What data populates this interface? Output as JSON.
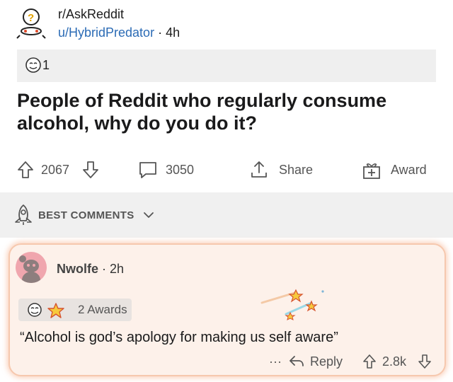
{
  "post": {
    "subreddit": "r/AskReddit",
    "username": "u/HybridPredator",
    "separator": "·",
    "age": "4h",
    "award_count": "1",
    "title": "People of Reddit who regularly consume alcohol, why do you do it?"
  },
  "actions": {
    "upvotes": "2067",
    "comments": "3050",
    "share": "Share",
    "award": "Award"
  },
  "sort": {
    "label": "BEST COMMENTS"
  },
  "comment": {
    "username": "Nwolfe",
    "separator": "·",
    "age": "2h",
    "awards_label": "2 Awards",
    "text": "“Alcohol is god’s apology for making us self aware”",
    "more": "···",
    "reply": "Reply",
    "score": "2.8k"
  },
  "colors": {
    "link_blue": "#2b6bb5",
    "card_bg": "#fdf1ea",
    "card_border": "#f6c8ae",
    "avatar_pink": "#f0a6ae"
  }
}
